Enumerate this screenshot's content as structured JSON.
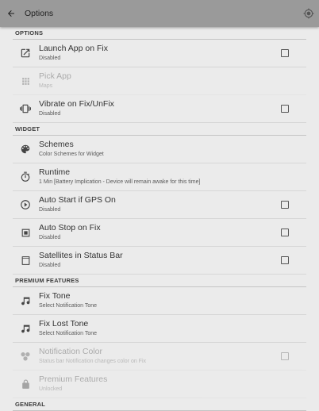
{
  "appbar": {
    "title": "Options"
  },
  "sections": {
    "options": "OPTIONS",
    "widget": "WIDGET",
    "premium": "PREMIUM FEATURES",
    "general": "GENERAL"
  },
  "items": {
    "launch_app": {
      "title": "Launch App on Fix",
      "sub": "Disabled"
    },
    "pick_app": {
      "title": "Pick App",
      "sub": "Maps"
    },
    "vibrate": {
      "title": "Vibrate on Fix/UnFix",
      "sub": "Disabled"
    },
    "schemes": {
      "title": "Schemes",
      "sub": "Color Schemes for Widget"
    },
    "runtime": {
      "title": "Runtime",
      "sub": "1 Min [Battery Implication - Device will remain awake for this time]"
    },
    "auto_start": {
      "title": "Auto Start if GPS On",
      "sub": "Disabled"
    },
    "auto_stop": {
      "title": "Auto Stop on Fix",
      "sub": "Disabled"
    },
    "satellites": {
      "title": "Satellites in Status Bar",
      "sub": "Disabled"
    },
    "fix_tone": {
      "title": "Fix Tone",
      "sub": "Select Notification Tone"
    },
    "fix_lost_tone": {
      "title": "Fix Lost Tone",
      "sub": "Select Notification Tone"
    },
    "notif_color": {
      "title": "Notification Color",
      "sub": "Status bar Notification changes color on Fix"
    },
    "premium": {
      "title": "Premium Features",
      "sub": "Unlocked"
    }
  },
  "icons": {
    "back": "arrow-back-icon",
    "gps": "gps-fixed-icon",
    "launch": "open-in-new-icon",
    "apps": "apps-grid-icon",
    "vibrate": "vibration-icon",
    "palette": "palette-icon",
    "timer": "timer-icon",
    "play": "play-circle-icon",
    "stop": "stop-square-icon",
    "statusbar": "status-bar-icon",
    "music": "music-note-icon",
    "color": "color-dots-icon",
    "lock": "lock-icon"
  },
  "colors": {
    "appbar": "#9a9a9a",
    "background": "#ebebeb",
    "divider": "#d6d6d6",
    "text": "#333333"
  }
}
